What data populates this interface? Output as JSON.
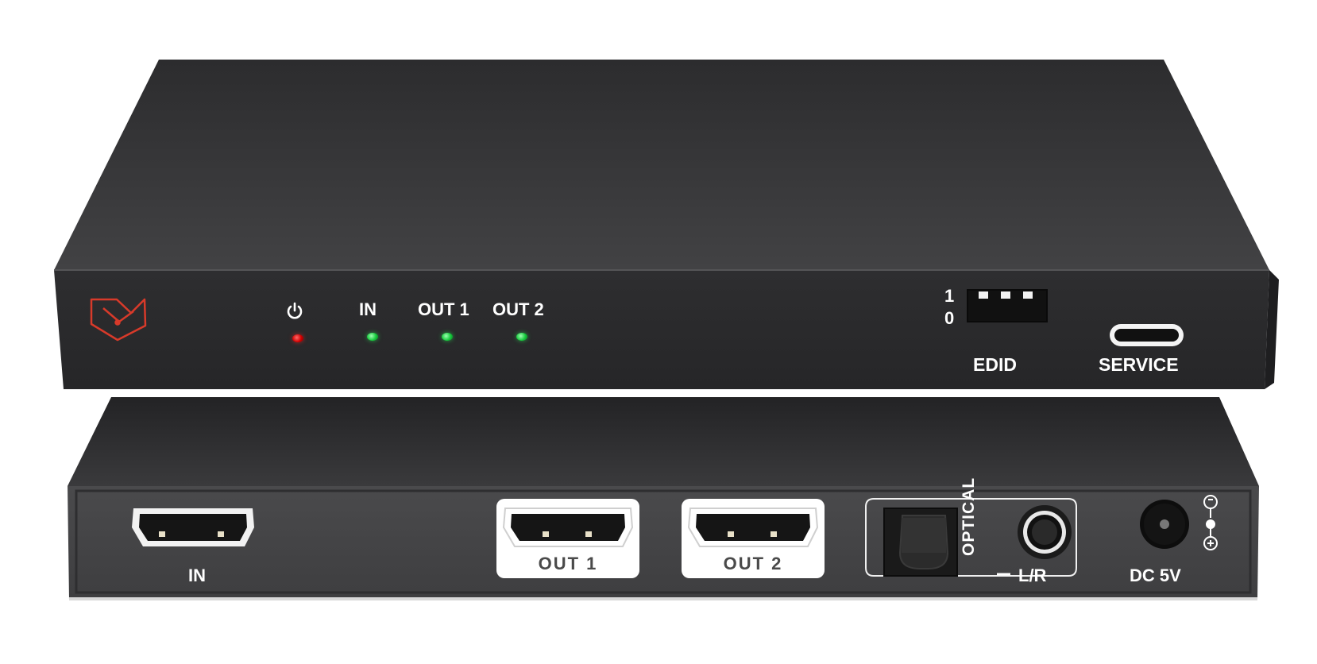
{
  "front_panel": {
    "indicators": [
      {
        "id": "power",
        "icon": "power-icon",
        "led_color": "#e00000"
      },
      {
        "id": "in",
        "label": "IN",
        "led_color": "#18d040"
      },
      {
        "id": "out1",
        "label": "OUT 1",
        "led_color": "#18d040"
      },
      {
        "id": "out2",
        "label": "OUT 2",
        "led_color": "#18d040"
      }
    ],
    "edid_switch": {
      "label": "EDID",
      "pos_high": "1",
      "pos_low": "0"
    },
    "service_port": {
      "label": "SERVICE"
    }
  },
  "rear_panel": {
    "hdmi_in": {
      "label": "IN"
    },
    "hdmi_out1": {
      "label": "OUT 1"
    },
    "hdmi_out2": {
      "label": "OUT 2"
    },
    "optical": {
      "label": "OPTICAL"
    },
    "analog_audio": {
      "label": "L/R"
    },
    "power": {
      "label": "DC 5V"
    }
  },
  "colors": {
    "housing": "#3c3c3e",
    "logo": "#d83a2a",
    "label_text": "#ffffff"
  }
}
